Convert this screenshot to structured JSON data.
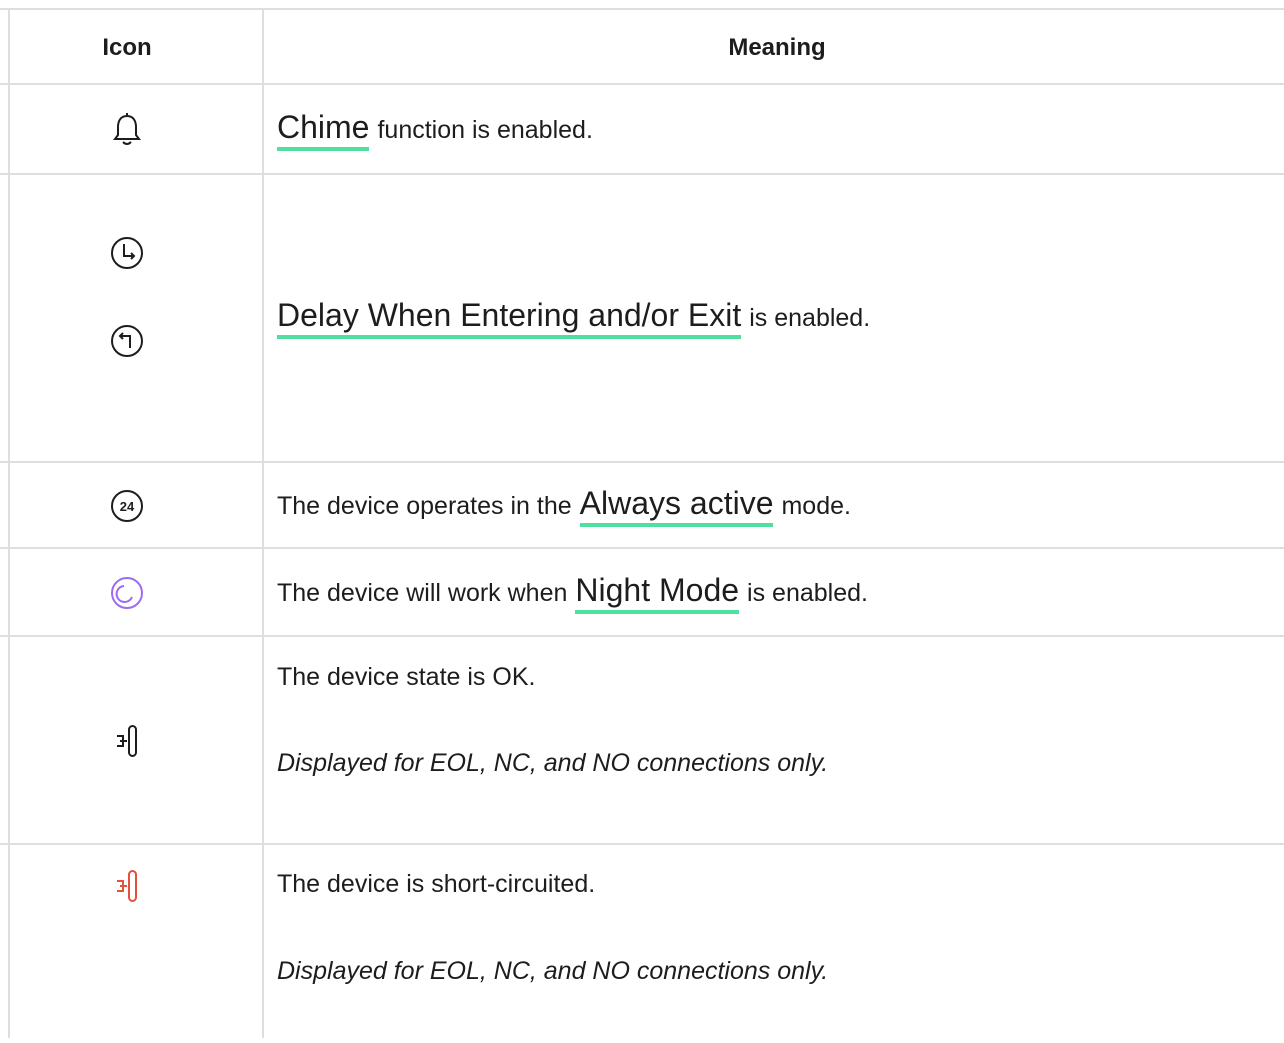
{
  "table": {
    "header": {
      "icon": "Icon",
      "meaning": "Meaning"
    },
    "rows": [
      {
        "icon": "bell-icon",
        "link": "Chime",
        "text": "function is enabled."
      },
      {
        "icons": [
          "clock-exit-icon",
          "clock-entry-icon"
        ],
        "link": "Delay When Entering and/or Exit",
        "text": "is enabled."
      },
      {
        "icon": "24-hour-icon",
        "icon_text": "24",
        "prefix": "The device operates in the",
        "link": "Always active",
        "text": "mode."
      },
      {
        "icon": "night-mode-icon",
        "icon_color": "#9d6cf0",
        "prefix": "The device will work when",
        "link": "Night Mode",
        "text": "is enabled."
      },
      {
        "icon": "connection-ok-icon",
        "text": "The device state is OK.",
        "note": "Displayed for EOL, NC, and NO connections only."
      },
      {
        "icon": "short-circuit-icon",
        "icon_color": "#e5503b",
        "text": "The device is short-circuited.",
        "note": "Displayed for EOL, NC, and NO connections only."
      }
    ]
  },
  "colors": {
    "link_underline": "#4fdfa1",
    "border": "#dedede"
  }
}
